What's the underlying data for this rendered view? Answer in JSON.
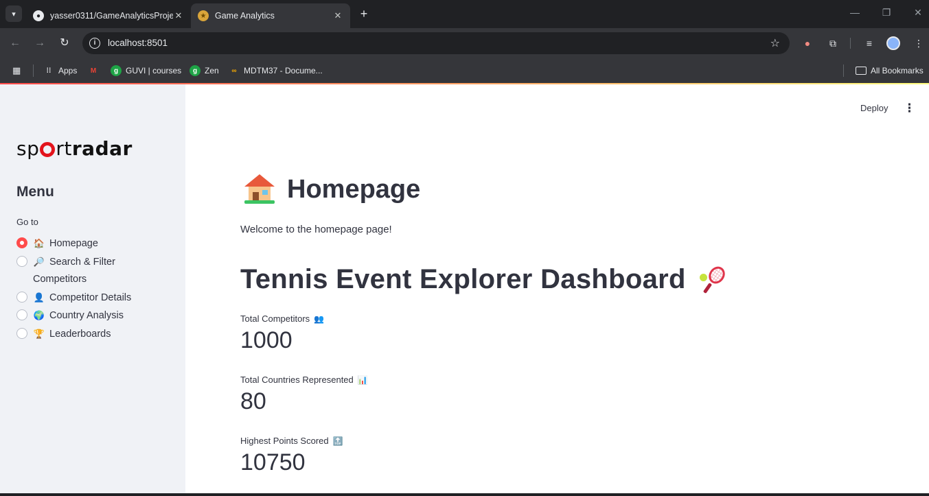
{
  "browser": {
    "tabs": [
      {
        "title": "yasser0311/GameAnalyticsProje",
        "active": false
      },
      {
        "title": "Game Analytics",
        "active": true
      }
    ],
    "url": "localhost:8501",
    "bookmarks": [
      {
        "label": "Apps",
        "icon": "apps-grid-icon"
      },
      {
        "label": "",
        "icon": "gmail-icon"
      },
      {
        "label": "GUVI | courses",
        "icon": "guvi-icon"
      },
      {
        "label": "Zen",
        "icon": "zen-icon"
      },
      {
        "label": "MDTM37 - Docume...",
        "icon": "mdtm-icon"
      }
    ],
    "all_bookmarks": "All Bookmarks"
  },
  "app": {
    "header": {
      "deploy_label": "Deploy"
    },
    "sidebar": {
      "logo": {
        "part1": "sp",
        "part2": "rt",
        "part3": "radar"
      },
      "menu_title": "Menu",
      "radio_label": "Go to",
      "options": [
        {
          "emoji": "🏠",
          "label": "Homepage",
          "selected": true
        },
        {
          "emoji": "🔎",
          "label": "Search & Filter Competitors",
          "selected": false
        },
        {
          "emoji": "👤",
          "label": "Competitor Details",
          "selected": false
        },
        {
          "emoji": "🌍",
          "label": "Country Analysis",
          "selected": false
        },
        {
          "emoji": "🏆",
          "label": "Leaderboards",
          "selected": false
        }
      ]
    },
    "main": {
      "title": "Homepage",
      "welcome": "Welcome to the homepage page!",
      "dashboard_title": "Tennis Event Explorer Dashboard",
      "metrics": [
        {
          "label": "Total Competitors",
          "icon": "👥",
          "value": "1000"
        },
        {
          "label": "Total Countries Represented",
          "icon": "📊",
          "value": "80"
        },
        {
          "label": "Highest Points Scored",
          "icon": "🔝",
          "value": "10750"
        }
      ]
    }
  },
  "colors": {
    "accent": "#ff4b4b",
    "sidebar_bg": "#f0f2f6",
    "text": "#31333f",
    "logo_red": "#e3141c"
  }
}
